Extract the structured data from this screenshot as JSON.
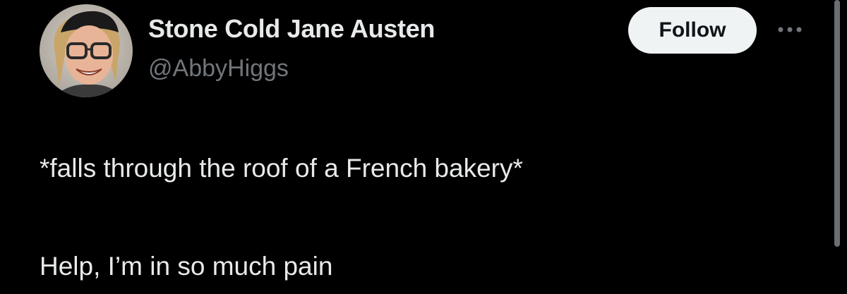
{
  "author": {
    "display_name": "Stone Cold Jane Austen",
    "handle": "@AbbyHiggs",
    "avatar_icon": "avatar-photo-icon"
  },
  "actions": {
    "follow_label": "Follow",
    "more_icon": "ellipsis-icon"
  },
  "tweet": {
    "lines": [
      "*falls through the roof of a French bakery*",
      "Help, I’m in so much pain"
    ]
  },
  "colors": {
    "background": "#000000",
    "primary_text": "#e7e9ea",
    "secondary_text": "#71767b",
    "follow_button_bg": "#eff3f4",
    "follow_button_text": "#0f1419"
  }
}
